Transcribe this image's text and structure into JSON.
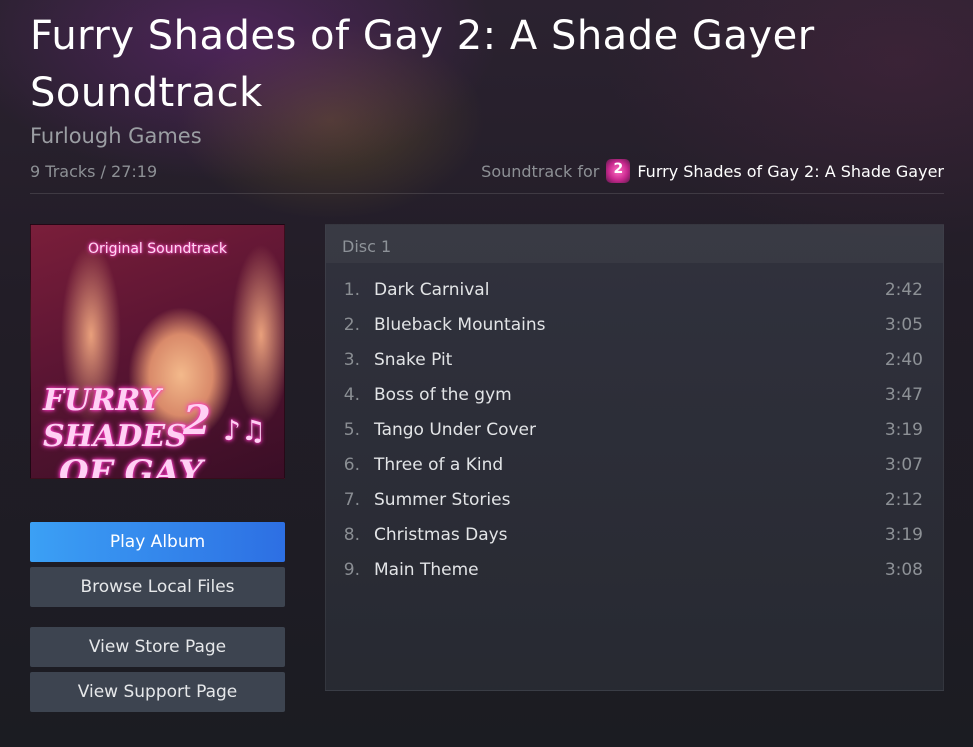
{
  "album": {
    "title": "Furry Shades of Gay 2: A Shade Gayer Soundtrack",
    "developer": "Furlough Games",
    "summary": "9 Tracks / 27:19",
    "soundtrack_for_label": "Soundtrack for",
    "game_name": "Furry Shades of Gay 2: A Shade Gayer"
  },
  "cover": {
    "subtitle": "Original Soundtrack",
    "logo_line1": "FURRY SHADES",
    "logo_line2": "OF GAY",
    "logo_number": "2",
    "logo_notes": "♪♫"
  },
  "buttons": {
    "play": "Play Album",
    "browse": "Browse Local Files",
    "store": "View Store Page",
    "support": "View Support Page"
  },
  "disc": {
    "label": "Disc 1",
    "tracks": [
      {
        "num": "1.",
        "title": "Dark Carnival",
        "duration": "2:42"
      },
      {
        "num": "2.",
        "title": "Blueback Mountains",
        "duration": "3:05"
      },
      {
        "num": "3.",
        "title": "Snake Pit",
        "duration": "2:40"
      },
      {
        "num": "4.",
        "title": "Boss of the gym",
        "duration": "3:47"
      },
      {
        "num": "5.",
        "title": "Tango Under Cover",
        "duration": "3:19"
      },
      {
        "num": "6.",
        "title": "Three of a Kind",
        "duration": "3:07"
      },
      {
        "num": "7.",
        "title": "Summer Stories",
        "duration": "2:12"
      },
      {
        "num": "8.",
        "title": "Christmas Days",
        "duration": "3:19"
      },
      {
        "num": "9.",
        "title": "Main Theme",
        "duration": "3:08"
      }
    ]
  },
  "colors": {
    "accent_start": "#3ba0f5",
    "accent_end": "#2d6fe3",
    "button_bg": "#3d4450"
  }
}
